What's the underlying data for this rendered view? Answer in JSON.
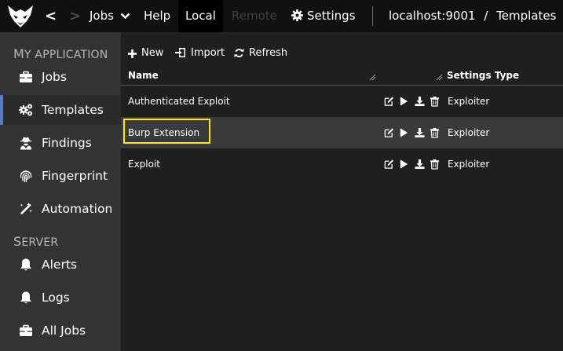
{
  "topbar": {
    "back_label": "<",
    "forward_label": ">",
    "jobs_label": "Jobs",
    "help_label": "Help",
    "local_label": "Local",
    "remote_label": "Remote",
    "settings_label": "Settings",
    "host": "localhost:9001",
    "breadcrumb_sep": "/",
    "breadcrumb_current": "Templates"
  },
  "sidebar": {
    "sections": [
      {
        "title_first": "M",
        "title_rest": "Y APPLICATION"
      },
      {
        "title_first": "S",
        "title_rest": "ERVER"
      }
    ],
    "items": [
      {
        "label": "Jobs",
        "icon": "briefcase-icon"
      },
      {
        "label": "Templates",
        "icon": "cogs-icon"
      },
      {
        "label": "Findings",
        "icon": "user-secret-icon"
      },
      {
        "label": "Fingerprint",
        "icon": "fingerprint-icon"
      },
      {
        "label": "Automation",
        "icon": "magic-wand-icon"
      },
      {
        "label": "Alerts",
        "icon": "bell-icon"
      },
      {
        "label": "Logs",
        "icon": "bell-icon"
      },
      {
        "label": "All Jobs",
        "icon": "briefcase-icon"
      }
    ],
    "selected": "Templates"
  },
  "toolbar": {
    "new_label": "New",
    "import_label": "Import",
    "refresh_label": "Refresh"
  },
  "table": {
    "columns": [
      "Name",
      "Settings Type"
    ],
    "rows": [
      {
        "name": "Authenticated Exploit",
        "type": "Exploiter"
      },
      {
        "name": "Burp Extension",
        "type": "Exploiter"
      },
      {
        "name": "Exploit",
        "type": "Exploiter"
      }
    ],
    "highlighted_row": "Burp Extension"
  },
  "colors": {
    "topbar_bg": "#111111",
    "sidebar_bg": "#333333",
    "main_bg": "#1f1f1f",
    "selected_accent": "#5d7ac3",
    "focus_outline": "#ffeb00"
  }
}
